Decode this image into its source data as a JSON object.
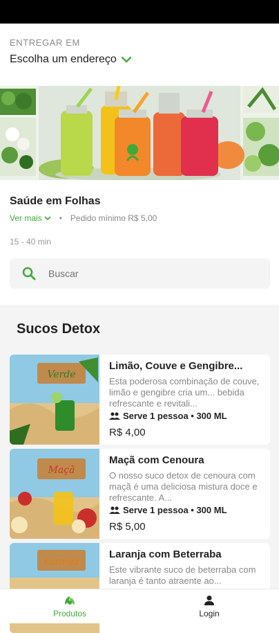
{
  "delivery": {
    "label": "ENTREGAR EM",
    "address_placeholder": "Escolha um endereço"
  },
  "store": {
    "name": "Saúde em Folhas",
    "see_more": "Ver mais",
    "separator": "•",
    "min_order": "Pedido mínimo R$ 5,00",
    "delivery_time": "15 - 40 min"
  },
  "search": {
    "placeholder": "Buscar"
  },
  "section": {
    "title": "Sucos Detox"
  },
  "products": [
    {
      "title": "Limão, Couve e Gengibre...",
      "description": "Esta poderosa combinação de couve, limão e gengibre cria um... bebida refrescante e revitali...",
      "serves": "Serve 1 pessoa • 300 ML",
      "price": "R$ 4,00",
      "thumb_label": "Verde"
    },
    {
      "title": "Maçã com Cenoura",
      "description": "O nosso suco detox de cenoura com maçã é uma deliciosa mistura doce e refrescante. A...",
      "serves": "Serve 1 pessoa • 300 ML",
      "price": "R$ 5,00",
      "thumb_label": "Maçã"
    },
    {
      "title": "Laranja com Beterraba",
      "description": "Este vibrante suco de beterraba com laranja é tanto atraente ao...",
      "serves": "",
      "price": "",
      "thumb_label": "Laranja"
    }
  ],
  "tabbar": {
    "products": "Produtos",
    "login": "Login"
  },
  "colors": {
    "accent": "#3fa93a",
    "text": "#222222",
    "muted": "#888888",
    "section_bg": "#f4f4f4"
  }
}
